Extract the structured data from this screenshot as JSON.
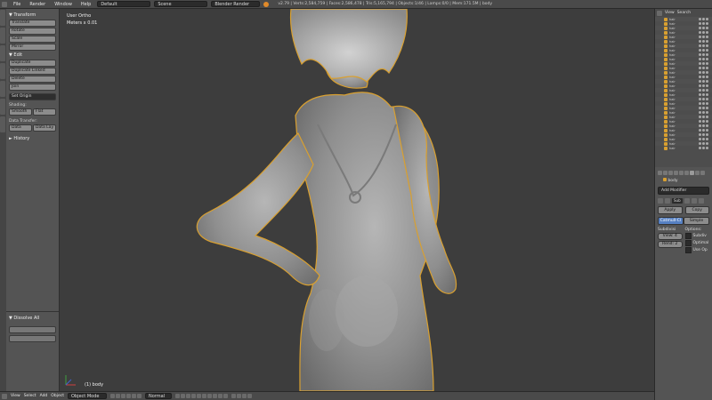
{
  "header": {
    "menus": [
      "File",
      "Render",
      "Window",
      "Help"
    ],
    "layout": "Default",
    "scene": "Scene",
    "engine": "Blender Render",
    "stats": "v2.79 | Verts:2,584,759 | Faces:2,586,478 | Tris:5,165,794 | Objects:1/46 | Lamps:0/0 | Mem:171.5M | body"
  },
  "toolshelf": {
    "transform_header": "▼ Transform",
    "transform": [
      "Translate",
      "Rotate",
      "Scale",
      "Mirror"
    ],
    "edit_header": "▼ Edit",
    "edit": [
      "Duplicate",
      "Duplicate Linked",
      "Delete",
      "Join"
    ],
    "set_origin": "Set Origin",
    "shading_label": "Shading:",
    "smooth": "Smooth",
    "flat": "Flat",
    "data_transfer_label": "Data Transfer:",
    "data": "Data",
    "data_layout": "Data Lay",
    "history_header": "► History",
    "redo_header": "▼ Dissolve All"
  },
  "viewport": {
    "view_name": "User Ortho",
    "units": "Meters x 0.01",
    "object_label": "(1) body"
  },
  "footer": {
    "view": "View",
    "select": "Select",
    "add": "Add",
    "object": "Object",
    "mode": "Object Mode",
    "pivot": "Normal"
  },
  "outliner": {
    "view": "View",
    "search": "Search",
    "rows": [
      "hair",
      "hair",
      "hair",
      "hair",
      "hair",
      "hair",
      "hair",
      "hair",
      "hair",
      "hair",
      "hair",
      "hair",
      "hair",
      "hair",
      "hair",
      "hair",
      "hair",
      "hair",
      "hair",
      "hair",
      "hair",
      "hair",
      "hair",
      "hair",
      "hair",
      "hair",
      "hair",
      "hair",
      "hair",
      "hair"
    ]
  },
  "properties": {
    "breadcrumb": "body",
    "add_modifier": "Add Modifier",
    "modifier_name": "Sub",
    "apply": "Apply",
    "copy": "Copy",
    "catmull": "Catmull-Cl",
    "simple": "Simple",
    "subdivisions": "Subdivisi",
    "options": "Options:",
    "view_level": "View: 4",
    "render_level": "Rend: 2",
    "subdiv_uvs": "Subdiv",
    "optimal": "Optimal",
    "use_opensubdiv": "Use Op"
  },
  "colors": {
    "accent": "#5680c2",
    "selection_outline": "#d9a030",
    "viewport_bg": "#3d3d3d"
  }
}
